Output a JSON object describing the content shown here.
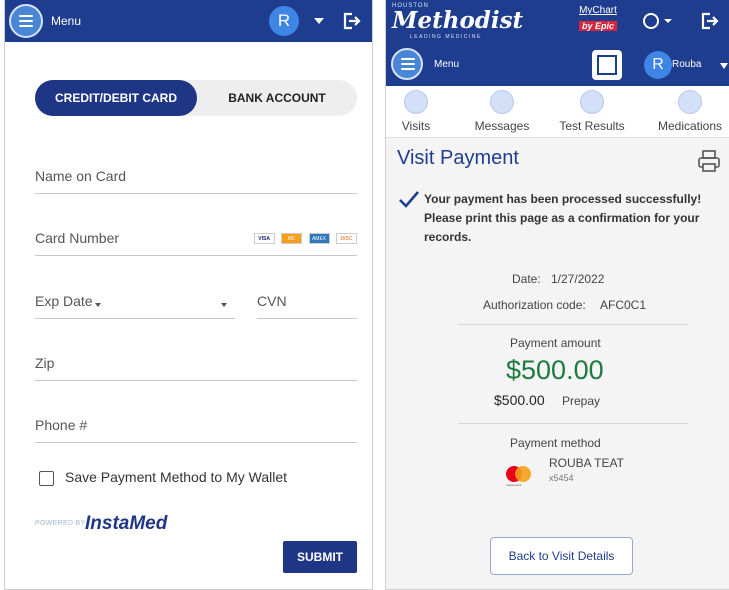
{
  "left": {
    "header": {
      "menu_label": "Menu",
      "avatar_initial": "R"
    },
    "payment_tabs": {
      "card_label": "CREDIT/DEBIT CARD",
      "bank_label": "BANK ACCOUNT"
    },
    "form": {
      "name_placeholder": "Name on Card",
      "card_number_placeholder": "Card Number",
      "card_brands": [
        "VISA",
        "MC",
        "AMEX",
        "DISC"
      ],
      "exp_date_placeholder": "Exp Date",
      "cvn_placeholder": "CVN",
      "zip_placeholder": "Zip",
      "phone_placeholder": "Phone #",
      "save_wallet_label": "Save Payment Method to My Wallet",
      "save_wallet_checked": false
    },
    "powered_by": {
      "prefix": "POWERED BY",
      "brand": "InstaMed"
    },
    "submit_label": "SUBMIT"
  },
  "right": {
    "header": {
      "brand_top": "HOUSTON",
      "brand_name": "Methodist",
      "brand_tagline": "LEADING MEDICINE",
      "mychart_label": "MyChart",
      "mychart_by": "by Epic",
      "menu_label": "Menu",
      "avatar_initial": "R",
      "user_name": "Rouba"
    },
    "nav": [
      {
        "label": "Visits",
        "icon": "calendar-icon"
      },
      {
        "label": "Messages",
        "icon": "envelope-icon"
      },
      {
        "label": "Test Results",
        "icon": "flask-icon"
      },
      {
        "label": "Medications",
        "icon": "pill-icon"
      }
    ],
    "page_title": "Visit Payment",
    "confirmation_message": "Your payment has been processed successfully! Please print this page as a confirmation for your records.",
    "date_label": "Date:",
    "date_value": "1/27/2022",
    "auth_label": "Authorization code:",
    "auth_value": "AFC0C1",
    "amount_label": "Payment amount",
    "amount_value": "$500.00",
    "breakdown_amount": "$500.00",
    "breakdown_label": "Prepay",
    "method_label": "Payment method",
    "card_holder": "ROUBA TEAT",
    "card_last4": "x5454",
    "card_brand_text": "mastercard",
    "back_button_label": "Back to Visit Details"
  },
  "colors": {
    "header_blue": "#1f3d8e",
    "primary_button": "#1f3687",
    "amount_green": "#1d7a40",
    "epic_red": "#d7263d"
  }
}
